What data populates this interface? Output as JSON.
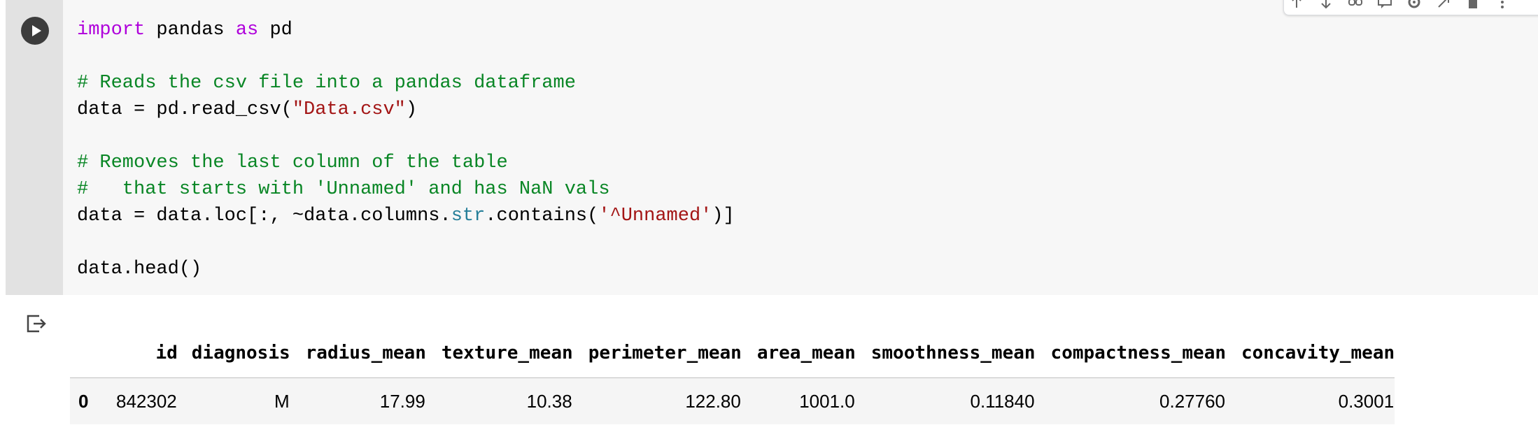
{
  "code_lines": [
    [
      {
        "t": "import",
        "c": "kw"
      },
      {
        "t": " pandas ",
        "c": ""
      },
      {
        "t": "as",
        "c": "kw"
      },
      {
        "t": " pd",
        "c": ""
      }
    ],
    [],
    [
      {
        "t": "# Reads the csv file into a pandas dataframe",
        "c": "cm"
      }
    ],
    [
      {
        "t": "data = pd.read_csv(",
        "c": ""
      },
      {
        "t": "\"Data.csv\"",
        "c": "st"
      },
      {
        "t": ")",
        "c": ""
      }
    ],
    [],
    [
      {
        "t": "# Removes the last column of the table",
        "c": "cm"
      }
    ],
    [
      {
        "t": "#   that starts with 'Unnamed' and has NaN vals",
        "c": "cm"
      }
    ],
    [
      {
        "t": "data = data.loc[:, ~data.columns.",
        "c": ""
      },
      {
        "t": "str",
        "c": "bi"
      },
      {
        "t": ".contains(",
        "c": ""
      },
      {
        "t": "'^Unnamed'",
        "c": "st"
      },
      {
        "t": ")]",
        "c": ""
      }
    ],
    [],
    [
      {
        "t": "data.head()",
        "c": ""
      }
    ]
  ],
  "table": {
    "columns": [
      "",
      "id",
      "diagnosis",
      "radius_mean",
      "texture_mean",
      "perimeter_mean",
      "area_mean",
      "smoothness_mean",
      "compactness_mean",
      "concavity_mean"
    ],
    "rows": [
      [
        "0",
        "842302",
        "M",
        "17.99",
        "10.38",
        "122.80",
        "1001.0",
        "0.11840",
        "0.27760",
        "0.3001"
      ]
    ]
  },
  "icons": {
    "run": "play-icon",
    "output": "output-icon",
    "toolbar": [
      "arrow-up-icon",
      "arrow-down-icon",
      "link-icon",
      "comment-icon",
      "gear-icon",
      "open-tab-icon",
      "delete-icon",
      "more-icon"
    ]
  }
}
